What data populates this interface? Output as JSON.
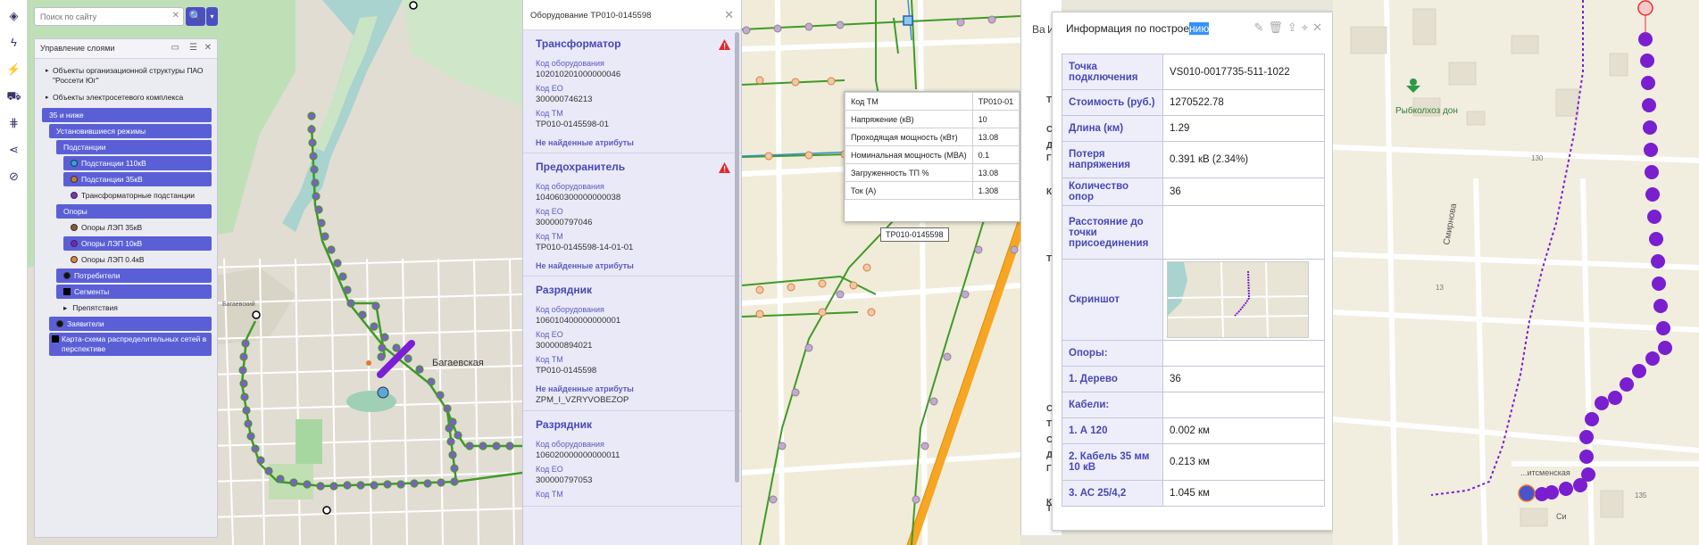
{
  "search": {
    "placeholder": "Поиск по сайту",
    "clear": "✕",
    "btn": "🔍",
    "dd": "▾"
  },
  "iconbar": [
    "layers-icon",
    "lightning-icon",
    "power-plug-icon",
    "truck-icon",
    "network-icon",
    "share-icon",
    "visibility-off-icon"
  ],
  "layers": {
    "title": "Управление слоями",
    "items": [
      {
        "type": "tx",
        "label": "Объекты организационной структуры ПАО \"Россети Юг\"",
        "indent": 0,
        "arrow": "▸"
      },
      {
        "type": "tx",
        "label": "Объекты электросетевого комплекса",
        "indent": 0,
        "arrow": "▸"
      },
      {
        "type": "bar",
        "label": "35 и ниже",
        "indent": 6
      },
      {
        "type": "bar",
        "label": "Установившиеся режимы",
        "indent": 14
      },
      {
        "type": "bar",
        "label": "Подстанции",
        "indent": 22
      },
      {
        "type": "bar",
        "label": "Подстанции 110кВ",
        "indent": 30,
        "dot": "#27a7e8"
      },
      {
        "type": "bar",
        "label": "Подстанции 35кВ",
        "indent": 30,
        "dot": "#c77b2e"
      },
      {
        "type": "plain",
        "label": "Трансформаторные подстанции 10кВ",
        "indent": 30,
        "dot": "#7b2fbf"
      },
      {
        "type": "bar",
        "label": "Опоры",
        "indent": 22
      },
      {
        "type": "plain",
        "label": "Опоры ЛЭП 35кВ",
        "indent": 30,
        "dot": "#8b5a2b"
      },
      {
        "type": "bar",
        "label": "Опоры ЛЭП 10кВ",
        "indent": 30,
        "dot": "#7a1fcf"
      },
      {
        "type": "plain",
        "label": "Опоры ЛЭП 0.4кВ",
        "indent": 30,
        "dot": "#e8832f"
      },
      {
        "type": "bar",
        "label": "Потребители",
        "indent": 22,
        "dot": "#111"
      },
      {
        "type": "bar",
        "label": "Сегменты",
        "indent": 22,
        "square": true
      },
      {
        "type": "plain",
        "label": "Препятствия",
        "indent": 22,
        "arrow": "▸"
      },
      {
        "type": "bar",
        "label": "Заявители",
        "indent": 14,
        "dot": "#111"
      },
      {
        "type": "bar2",
        "label": "Карта-схема распределительных сетей в перспективе",
        "indent": 14
      }
    ]
  },
  "map1": {
    "place_label": "Багаевская",
    "place_small": "Багаевский\nрайон"
  },
  "equipment": {
    "title": "Оборудование ТР010-0145598",
    "sections": [
      {
        "title": "Трансформатор",
        "warn": true,
        "fields": [
          [
            "Код оборудования",
            "102010201000000046"
          ],
          [
            "Код ЕО",
            "300000746213"
          ],
          [
            "Код ТМ",
            "ТР010-0145598-01"
          ]
        ],
        "nf": "Не найденные атрибуты",
        "nf_val": ""
      },
      {
        "title": "Предохранитель",
        "warn": true,
        "fields": [
          [
            "Код оборудования",
            "104060300000000038"
          ],
          [
            "Код ЕО",
            "300000797046"
          ],
          [
            "Код ТМ",
            "ТР010-0145598-14-01-01"
          ]
        ],
        "nf": "Не найденные атрибуты",
        "nf_val": ""
      },
      {
        "title": "Разрядник",
        "warn": false,
        "fields": [
          [
            "Код оборудования",
            "106010400000000001"
          ],
          [
            "Код ЕО",
            "300000894021"
          ],
          [
            "Код ТМ",
            "ТР010-0145598"
          ]
        ],
        "nf": "Не найденные атрибуты",
        "nf_val": "ZPM_I_VZRYVOBEZOP"
      },
      {
        "title": "Разрядник",
        "warn": false,
        "fields": [
          [
            "Код оборудования",
            "106020000000000011"
          ],
          [
            "Код ЕО",
            "300000797053"
          ],
          [
            "Код ТМ",
            ""
          ]
        ],
        "nf": "",
        "nf_val": ""
      }
    ]
  },
  "popup": {
    "rows": [
      [
        "Код ТМ",
        "ТР010-01"
      ],
      [
        "Напряжение (кВ)",
        "10"
      ],
      [
        "Проходящая мощность (кВт)",
        "13.08"
      ],
      [
        "Номинальная мощность (МВА)",
        "0.1"
      ],
      [
        "Загруженность ТП %",
        "13.08"
      ],
      [
        "Ток (А)",
        "1.308"
      ]
    ],
    "label": "ТР010-0145598"
  },
  "side_tabs": {
    "a": "Ва",
    "b": "Ин",
    "letters": [
      "Т",
      "С",
      "Д",
      "Г",
      "К",
      "Т",
      "С",
      "Т",
      "С",
      "Д",
      "Г",
      "К",
      "Т"
    ]
  },
  "info": {
    "title_start": "Информация по построе",
    "title_selected": "нию",
    "rows": [
      {
        "k": "Точка подключения",
        "v": "VS010-0017735-511-1022"
      },
      {
        "k": "Стоимость (руб.)",
        "v": "1270522.78"
      },
      {
        "k": "Длина (км)",
        "v": "1.29"
      },
      {
        "k": "Потеря напряжения",
        "v": "0.391 кВ (2.34%)"
      },
      {
        "k": "Количество опор",
        "v": "36"
      },
      {
        "k": "Расстояние до точки присоединения",
        "v": ""
      },
      {
        "k": "Скриншот",
        "v": "",
        "thumb": true
      },
      {
        "k": "Опоры:",
        "v": ""
      },
      {
        "k": "1. Дерево",
        "v": "36"
      },
      {
        "k": "Кабели:",
        "v": ""
      },
      {
        "k": "1. А 120",
        "v": "0.002 км"
      },
      {
        "k": "2. Кабель 35 мм 10 кВ",
        "v": "0.213 км"
      },
      {
        "k": "3. АС 25/4,2",
        "v": "1.045 км"
      }
    ]
  },
  "map3": {
    "poi": "Рыбколхоз дон",
    "street1": "Смирнова",
    "street2": "...итсменская",
    "n1": "130",
    "n2": "13",
    "n3": "135",
    "n4": "Си"
  }
}
